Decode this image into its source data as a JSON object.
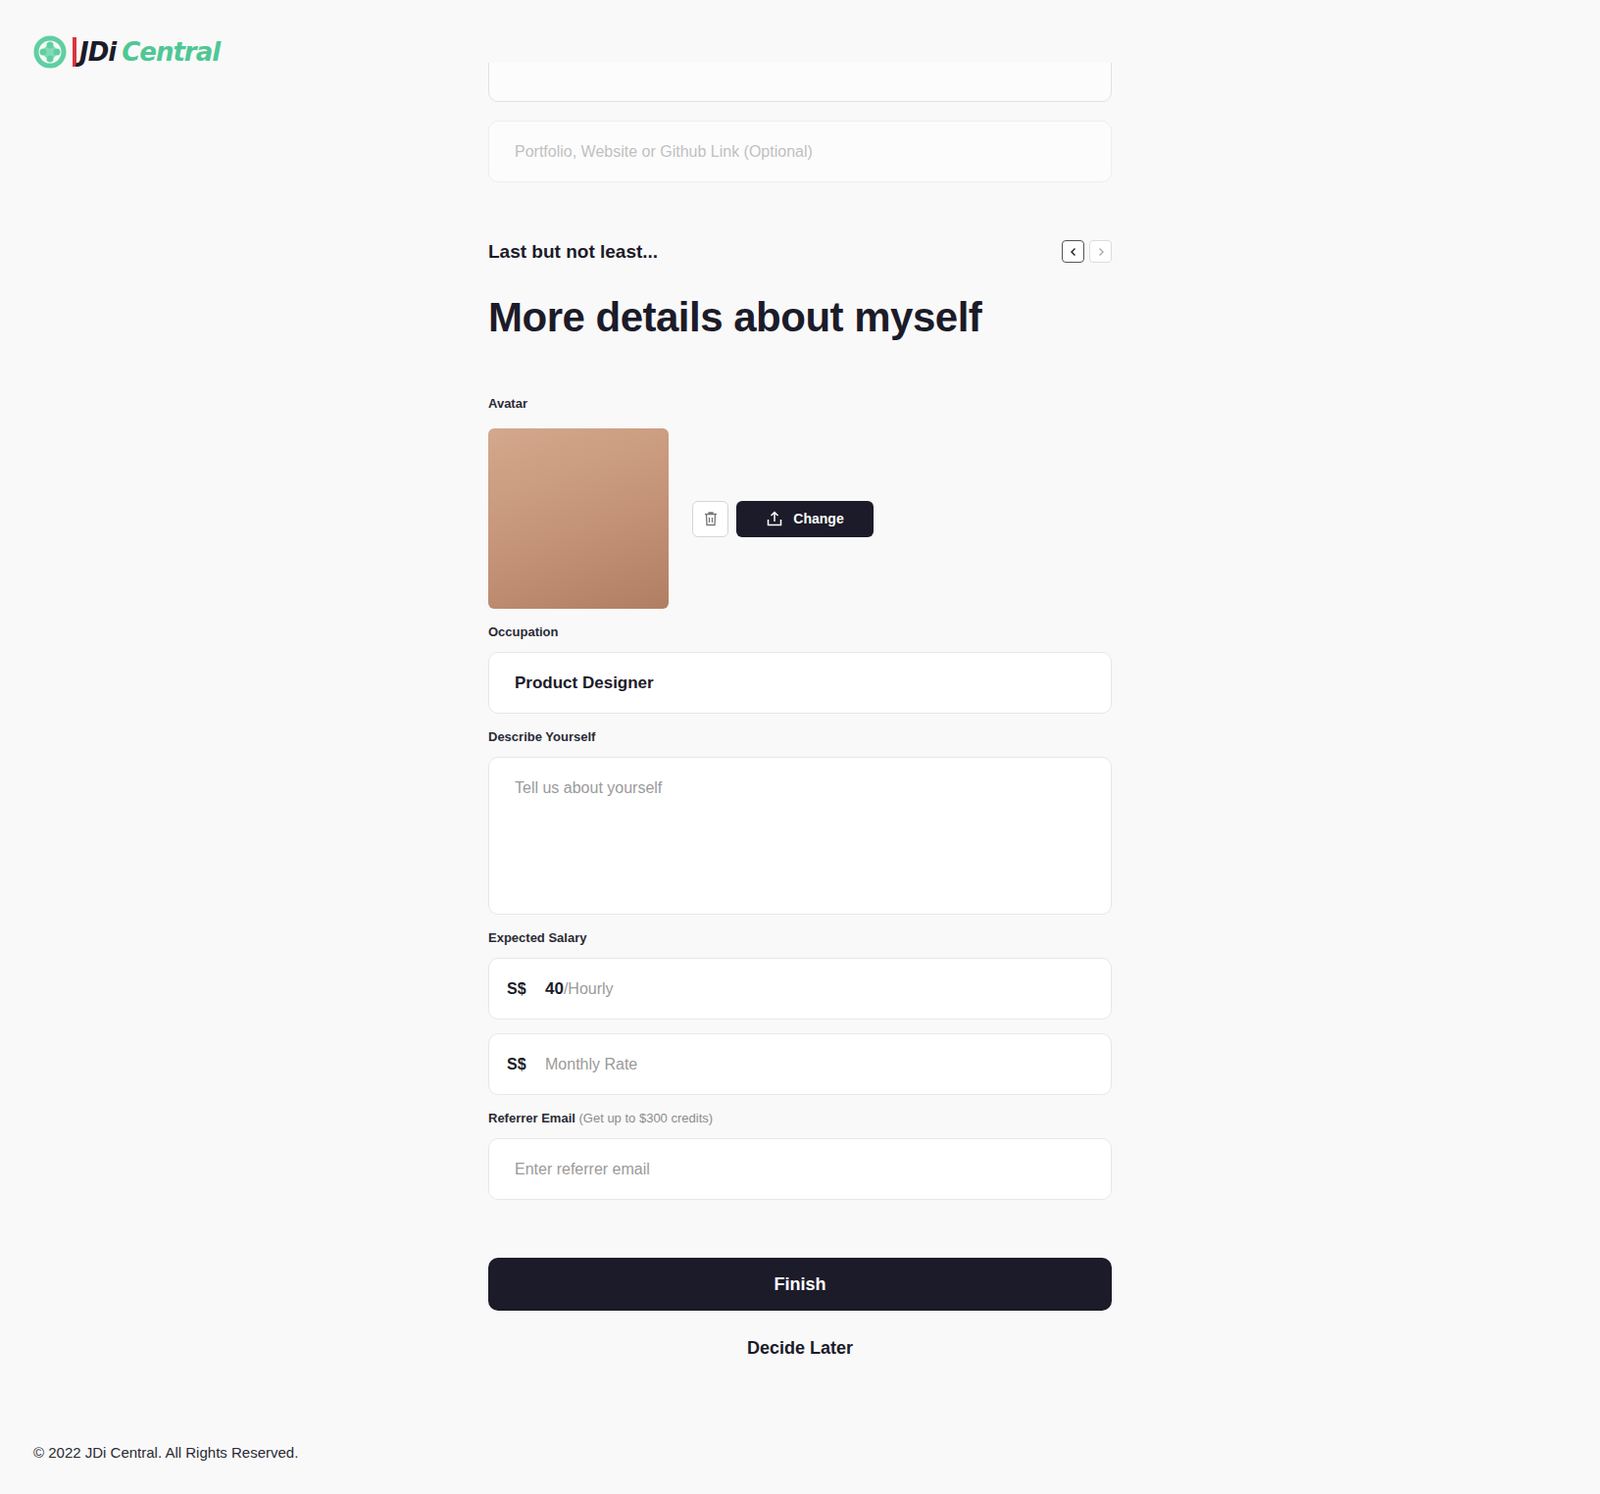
{
  "logo": {
    "brand": "JDi",
    "name": "Central"
  },
  "portfolio": {
    "placeholder": "Portfolio, Website or Github Link (Optional)"
  },
  "section": {
    "eyebrow": "Last but not least...",
    "title": "More details about myself",
    "prev_disabled": false,
    "next_disabled": true
  },
  "avatar": {
    "label": "Avatar",
    "change": "Change"
  },
  "occupation": {
    "label": "Occupation",
    "value": "Product Designer"
  },
  "describe": {
    "label": "Describe Yourself",
    "placeholder": "Tell us about yourself"
  },
  "salary": {
    "label": "Expected Salary",
    "fields": [
      {
        "currency": "S$",
        "value": "40",
        "unit": "/Hourly",
        "placeholder": ""
      },
      {
        "currency": "S$",
        "value": "",
        "unit": "",
        "placeholder": "Monthly Rate"
      }
    ]
  },
  "referrer": {
    "label": "Referrer Email",
    "hint": "(Get up to $300 credits)",
    "placeholder": "Enter referrer email"
  },
  "finish": "Finish",
  "later": "Decide Later",
  "footer": "© 2022 JDi Central. All Rights Reserved."
}
